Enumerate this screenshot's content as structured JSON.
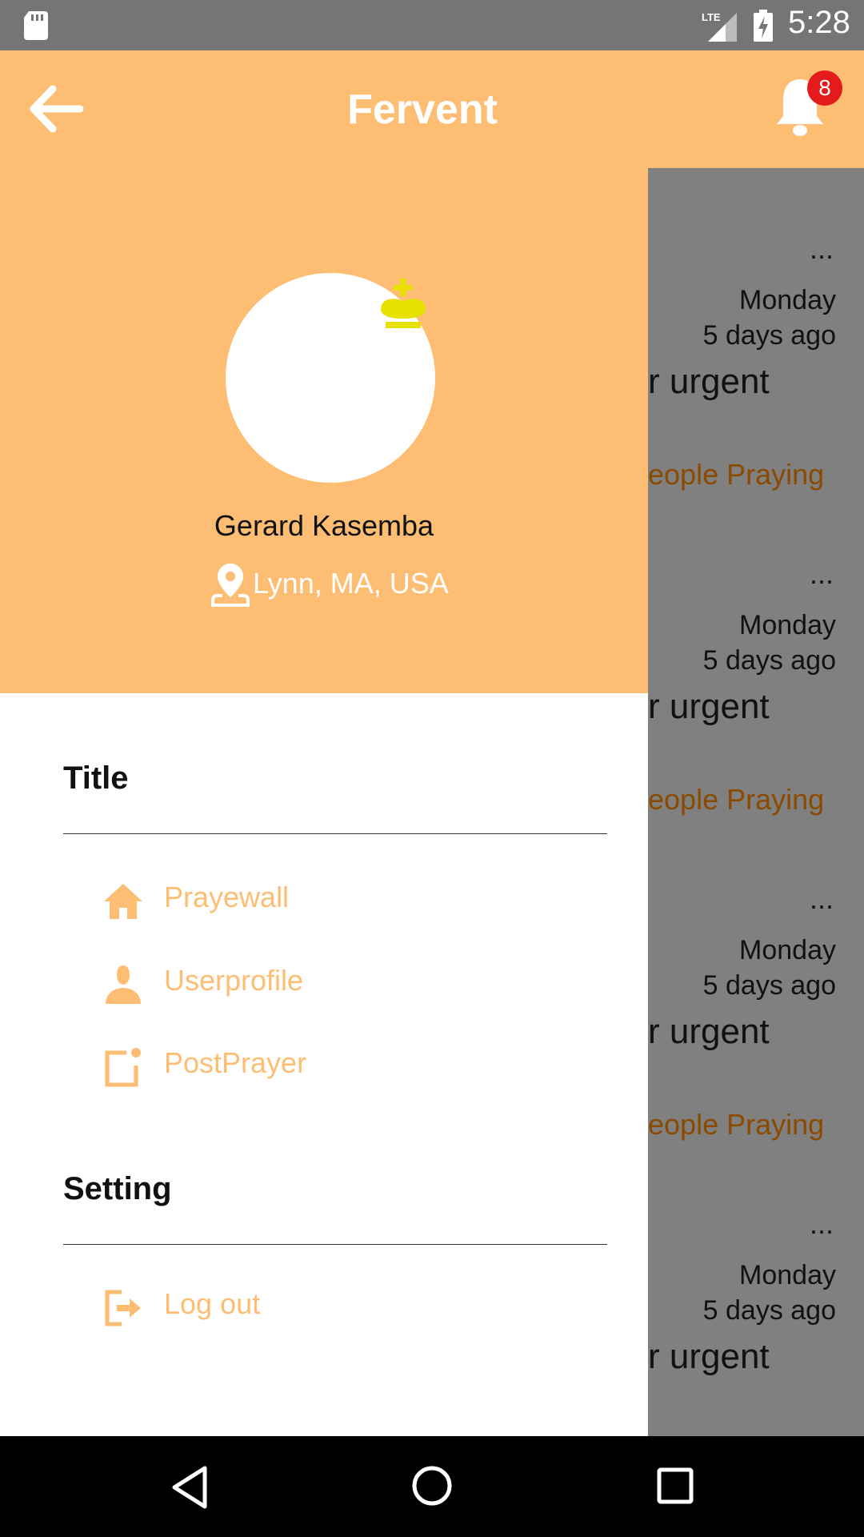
{
  "status_bar": {
    "time": "5:28",
    "network": "LTE",
    "icons": [
      "sd-card-icon",
      "lte-signal-icon",
      "battery-charging-icon"
    ]
  },
  "app_bar": {
    "title": "Fervent",
    "notification_count": "8",
    "icons": [
      "back-arrow-icon",
      "bell-icon"
    ]
  },
  "drawer": {
    "user": {
      "name": "Gerard Kasemba",
      "location": "Lynn, MA, USA"
    },
    "sections": [
      {
        "title": "Title",
        "items": [
          {
            "label": "Prayewall",
            "icon": "home-icon"
          },
          {
            "label": "Userprofile",
            "icon": "person-icon"
          },
          {
            "label": "PostPrayer",
            "icon": "new-post-icon"
          }
        ]
      },
      {
        "title": "Setting",
        "items": [
          {
            "label": "Log out",
            "icon": "logout-icon"
          }
        ]
      }
    ]
  },
  "feed": {
    "cards": [
      {
        "menu": "...",
        "day": "Monday",
        "ago": "5 days ago",
        "text": "r urgent",
        "praying": "eople Praying"
      },
      {
        "menu": "...",
        "day": "Monday",
        "ago": "5 days ago",
        "text": "r urgent",
        "praying": "eople Praying"
      },
      {
        "menu": "...",
        "day": "Monday",
        "ago": "5 days ago",
        "text": "r urgent",
        "praying": "eople Praying"
      },
      {
        "menu": "...",
        "day": "Monday",
        "ago": "5 days ago",
        "text": "r urgent",
        "praying": ""
      }
    ]
  },
  "colors": {
    "accent": "#fdbe74",
    "status_bar": "#757575",
    "scrim": "#808080",
    "badge": "#e51b1b",
    "crown": "#e8e000",
    "praying_text": "#8a4a00"
  }
}
